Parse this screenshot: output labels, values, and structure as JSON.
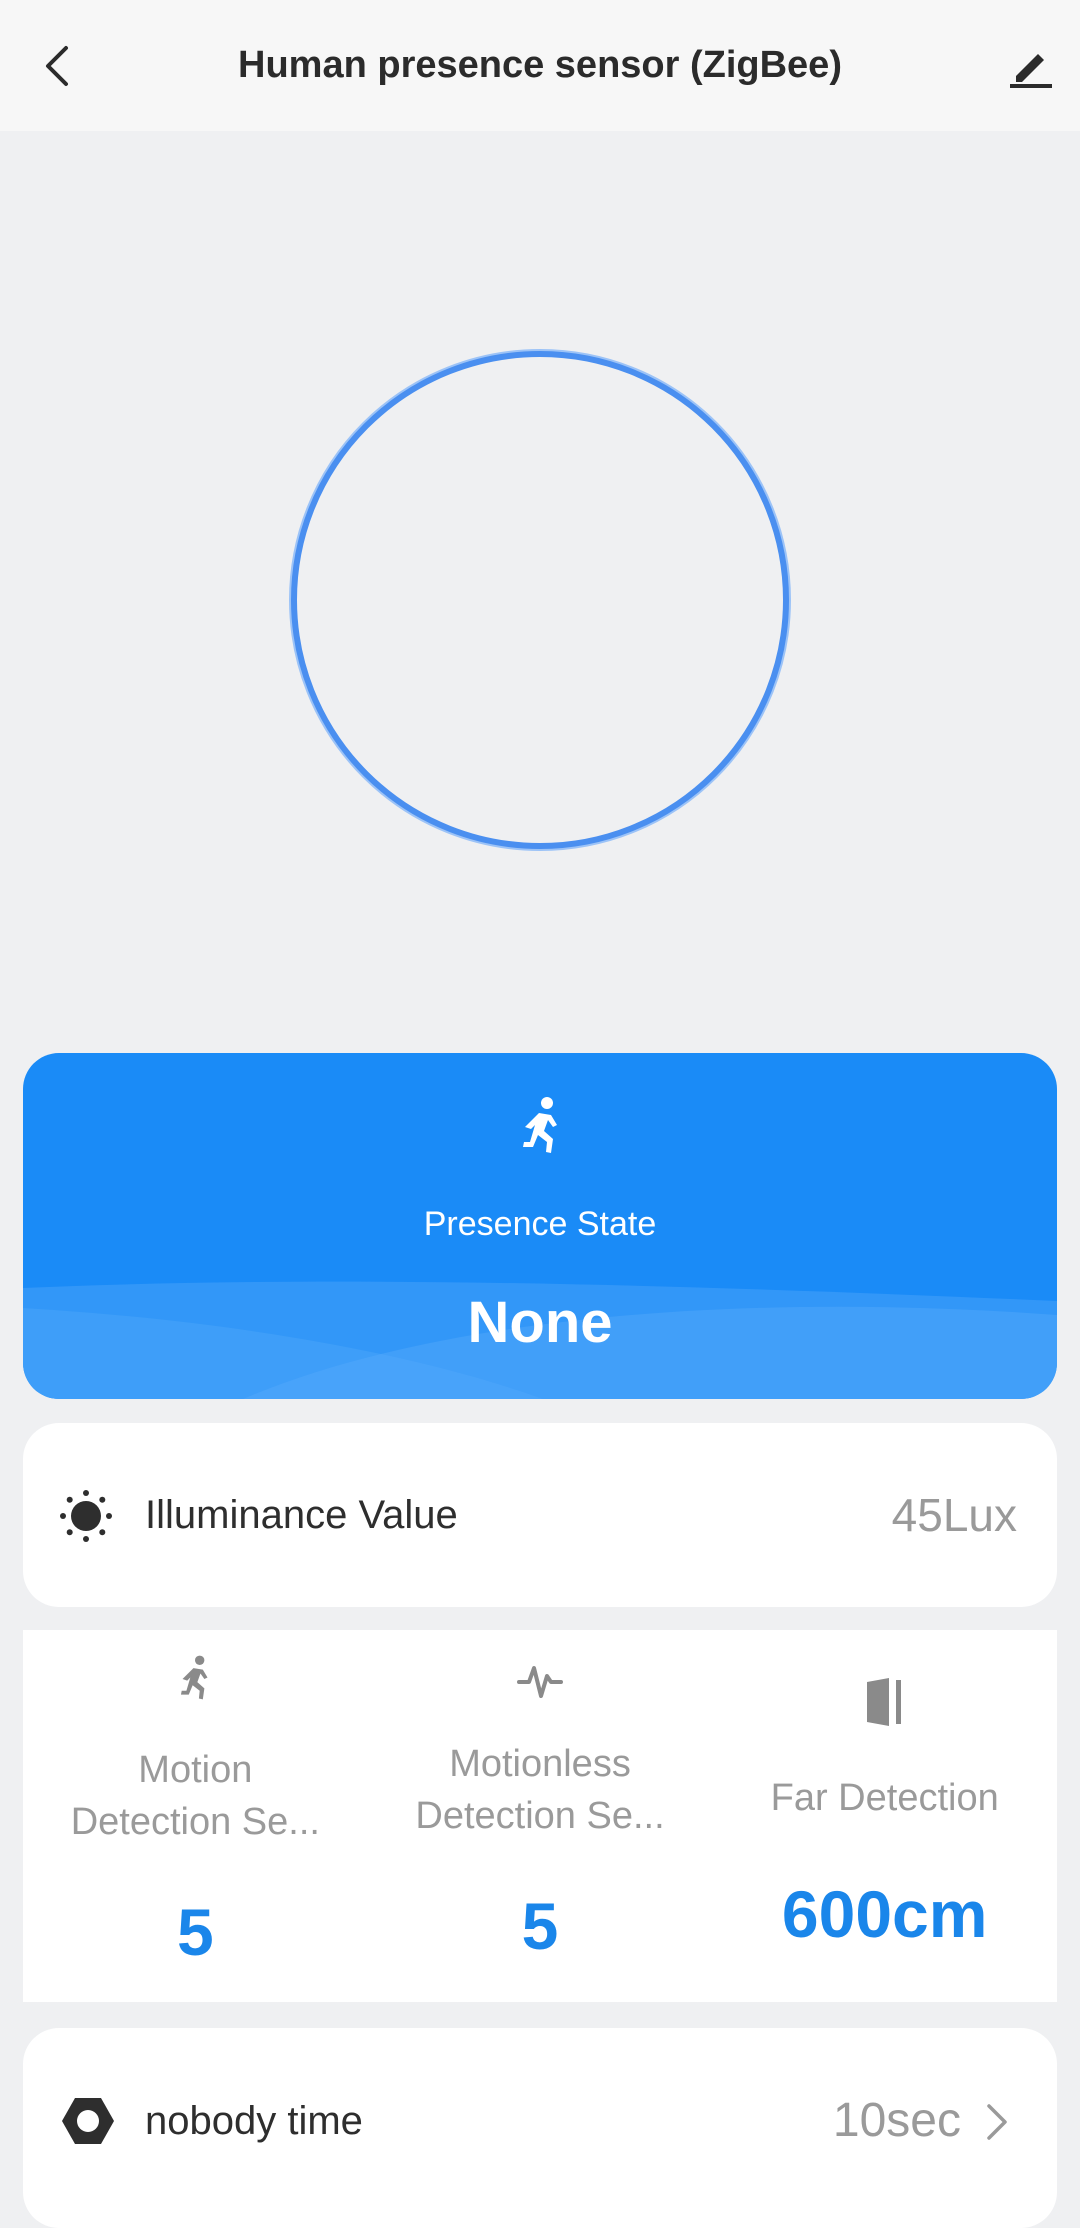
{
  "header": {
    "title": "Human presence sensor (ZigBee)",
    "back_icon": "chevron-left-icon",
    "edit_icon": "pencil-icon"
  },
  "status_ring": {
    "color": "#4a8ff0"
  },
  "presence": {
    "icon": "running-person-icon",
    "label": "Presence State",
    "value": "None",
    "color": "#1a8bf7"
  },
  "illuminance": {
    "icon": "sun-icon",
    "label": "Illuminance Value",
    "value": "45Lux"
  },
  "settings": [
    {
      "icon": "running-person-icon",
      "label_line1": "Motion",
      "label_line2": "Detection Se...",
      "value": "5"
    },
    {
      "icon": "pulse-icon",
      "label_line1": "Motionless",
      "label_line2": "Detection Se...",
      "value": "5"
    },
    {
      "icon": "door-icon",
      "label_line1": "Far Detection",
      "label_line2": "",
      "value": "600cm"
    }
  ],
  "nobody_time": {
    "icon": "hexagon-icon",
    "label": "nobody time",
    "value": "10sec",
    "chevron_icon": "chevron-right-icon"
  },
  "colors": {
    "accent": "#1a86ea",
    "background": "#eff0f2"
  }
}
